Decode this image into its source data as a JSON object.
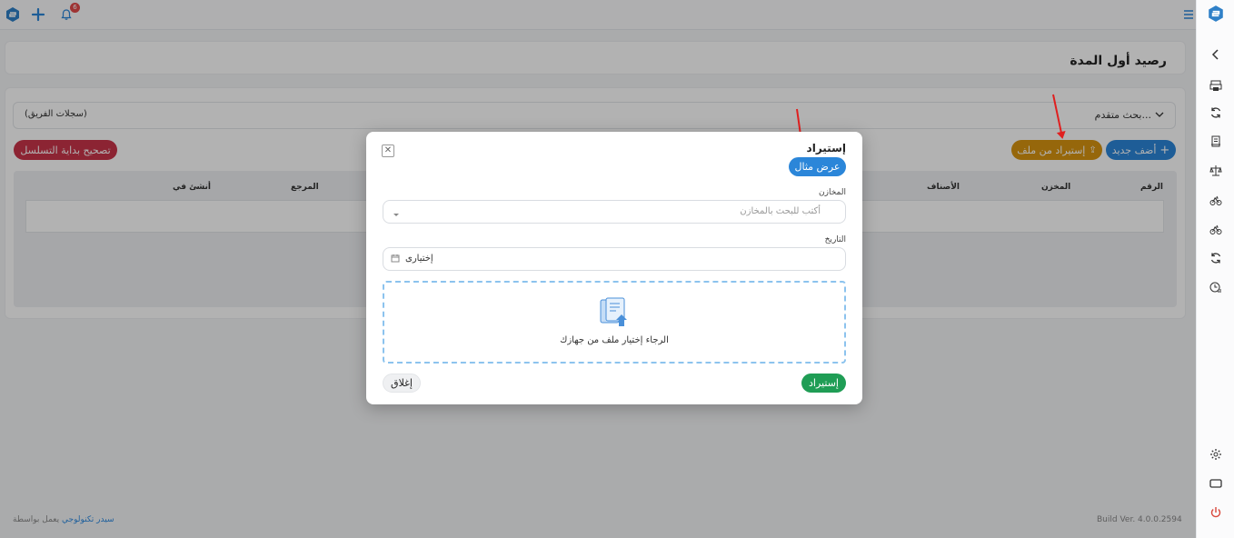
{
  "topbar": {
    "notif_count": "6"
  },
  "page": {
    "title": "رصيد أول المدة",
    "advanced_search": "بحث متقدم...",
    "team_records": "(سجلات الفريق)",
    "add_new": "أضف جديد",
    "import_from_file": "إستيراد من ملف",
    "fix_sequence": "تصحيح بداية التسلسل",
    "table_headers": [
      "الرقم",
      "المخزن",
      "الأصناف",
      "المرجع",
      "أنشئ في"
    ]
  },
  "footer": {
    "powered_prefix": "يعمل بواسطة",
    "company": "سيدر تكنولوجي",
    "build": "Build Ver. 4.0.0.2594"
  },
  "modal": {
    "title": "إستيراد",
    "show_example": "عرض مثال",
    "warehouses_label": "المخازن",
    "warehouses_placeholder": "أكتب للبحث بالمخازن",
    "date_label": "التاريخ",
    "date_placeholder": "إختيارى",
    "drop_text": "الرجاء إختيار ملف من جهازك",
    "import_button": "إستيراد",
    "close_button": "إغلاق"
  },
  "colors": {
    "primary_blue": "#2b86d9",
    "import_orange": "#d79410",
    "fix_red": "#c9344a",
    "import_green": "#1f9d55",
    "annotation_red": "#e01f1f"
  },
  "icons": {
    "sidebar": [
      "chevron-left-icon",
      "printer-icon",
      "refresh-icon",
      "receipt-icon",
      "scale-icon",
      "bicycle-icon",
      "bicycle-icon",
      "refresh-icon",
      "chart-clock-icon",
      "gear-icon",
      "window-icon",
      "power-icon"
    ],
    "topbar": [
      "logo-icon",
      "plus-icon",
      "bell-icon",
      "menu-icon"
    ]
  }
}
